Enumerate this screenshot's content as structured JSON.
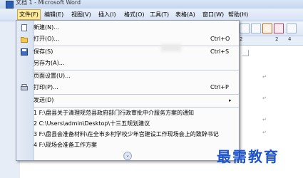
{
  "window": {
    "title": "文档 1 - Microsoft Word"
  },
  "menubar": [
    {
      "label": "文件(F)"
    },
    {
      "label": "编辑(E)"
    },
    {
      "label": "视图(V)"
    },
    {
      "label": "插入(I)"
    },
    {
      "label": "格式(O)"
    },
    {
      "label": "工具(T)"
    },
    {
      "label": "表格(A)"
    },
    {
      "label": "窗口(W)"
    },
    {
      "label": "帮助(H)"
    }
  ],
  "file_menu": {
    "items": [
      {
        "label": "新建(N)...",
        "shortcut": "",
        "icon": "new-document-icon"
      },
      {
        "label": "打开(O)...",
        "shortcut": "Ctrl+O",
        "icon": "open-folder-icon"
      },
      {
        "label": "保存(S)",
        "shortcut": "Ctrl+S",
        "icon": "save-icon"
      },
      {
        "label": "另存为(A)...",
        "shortcut": "",
        "icon": ""
      },
      {
        "label": "页面设置(U)...",
        "shortcut": "",
        "icon": ""
      },
      {
        "label": "打印(P)...",
        "shortcut": "Ctrl+P",
        "icon": "print-icon"
      },
      {
        "label": "发送(D)",
        "shortcut": "",
        "icon": "",
        "submenu_arrow": "▸"
      }
    ],
    "recent_files": [
      "1 F:\\盘县关于清理规范县政府部门行政审批中介服务方案的通知",
      "2 C:\\Users\\admin\\Desktop\\十三五规划建议",
      "3 F:\\盘县会准备材料\\在全市乡村学校少年宫建设工作现场会上的致辞书记",
      "4 F:\\现场会准备工作方案"
    ],
    "expand_icon": "double-chevron-down-icon",
    "expand_glyph": "⌄"
  },
  "ruler": {
    "ticks": [
      "2",
      "2",
      "4"
    ]
  },
  "watermark": {
    "text": "最需教育"
  }
}
